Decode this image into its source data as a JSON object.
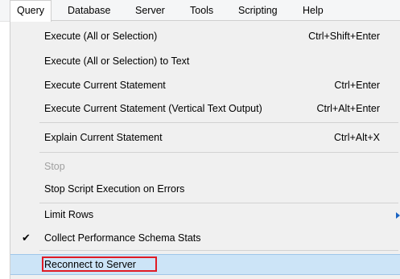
{
  "menubar": {
    "items": [
      {
        "label": "Query",
        "active": true
      },
      {
        "label": "Database"
      },
      {
        "label": "Server"
      },
      {
        "label": "Tools"
      },
      {
        "label": "Scripting"
      },
      {
        "label": "Help"
      }
    ]
  },
  "dropdown": {
    "items": [
      {
        "label": "Execute (All or Selection)",
        "shortcut": "Ctrl+Shift+Enter"
      },
      {
        "label": "Execute (All or Selection) to Text",
        "shortcut": ""
      },
      {
        "label": "Execute Current Statement",
        "shortcut": "Ctrl+Enter"
      },
      {
        "label": "Execute Current Statement (Vertical Text Output)",
        "shortcut": "Ctrl+Alt+Enter"
      },
      {
        "label": "Explain Current Statement",
        "shortcut": "Ctrl+Alt+X"
      },
      {
        "label": "Stop",
        "shortcut": "",
        "disabled": true
      },
      {
        "label": "Stop Script Execution on Errors",
        "shortcut": ""
      },
      {
        "label": "Limit Rows",
        "shortcut": "",
        "submenu": true
      },
      {
        "label": "Collect Performance Schema Stats",
        "shortcut": "",
        "checked": true
      },
      {
        "label": "Reconnect to Server",
        "shortcut": "",
        "highlighted": true
      }
    ],
    "check_glyph": "✔"
  },
  "colors": {
    "highlight": "#cce4f7",
    "annotation_box": "#e01b24",
    "submenu_arrow": "#1a63c2"
  }
}
